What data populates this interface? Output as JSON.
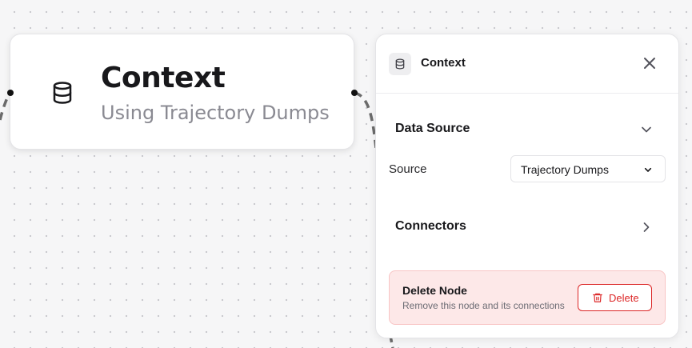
{
  "canvas": {
    "node": {
      "icon": "database-icon",
      "title": "Context",
      "subtitle": "Using Trajectory Dumps"
    }
  },
  "panel": {
    "header": {
      "icon": "database-icon",
      "title": "Context",
      "close_icon": "close-icon"
    },
    "data_source": {
      "title": "Data Source",
      "expanded": true,
      "field_label": "Source",
      "selected": "Trajectory Dumps"
    },
    "connectors": {
      "title": "Connectors",
      "expanded": false
    },
    "danger": {
      "title": "Delete Node",
      "description": "Remove this node and its connections",
      "button_label": "Delete"
    }
  },
  "colors": {
    "danger": "#dc2626",
    "danger_bg": "#fde8e8",
    "edge": "#6b6b6b"
  }
}
